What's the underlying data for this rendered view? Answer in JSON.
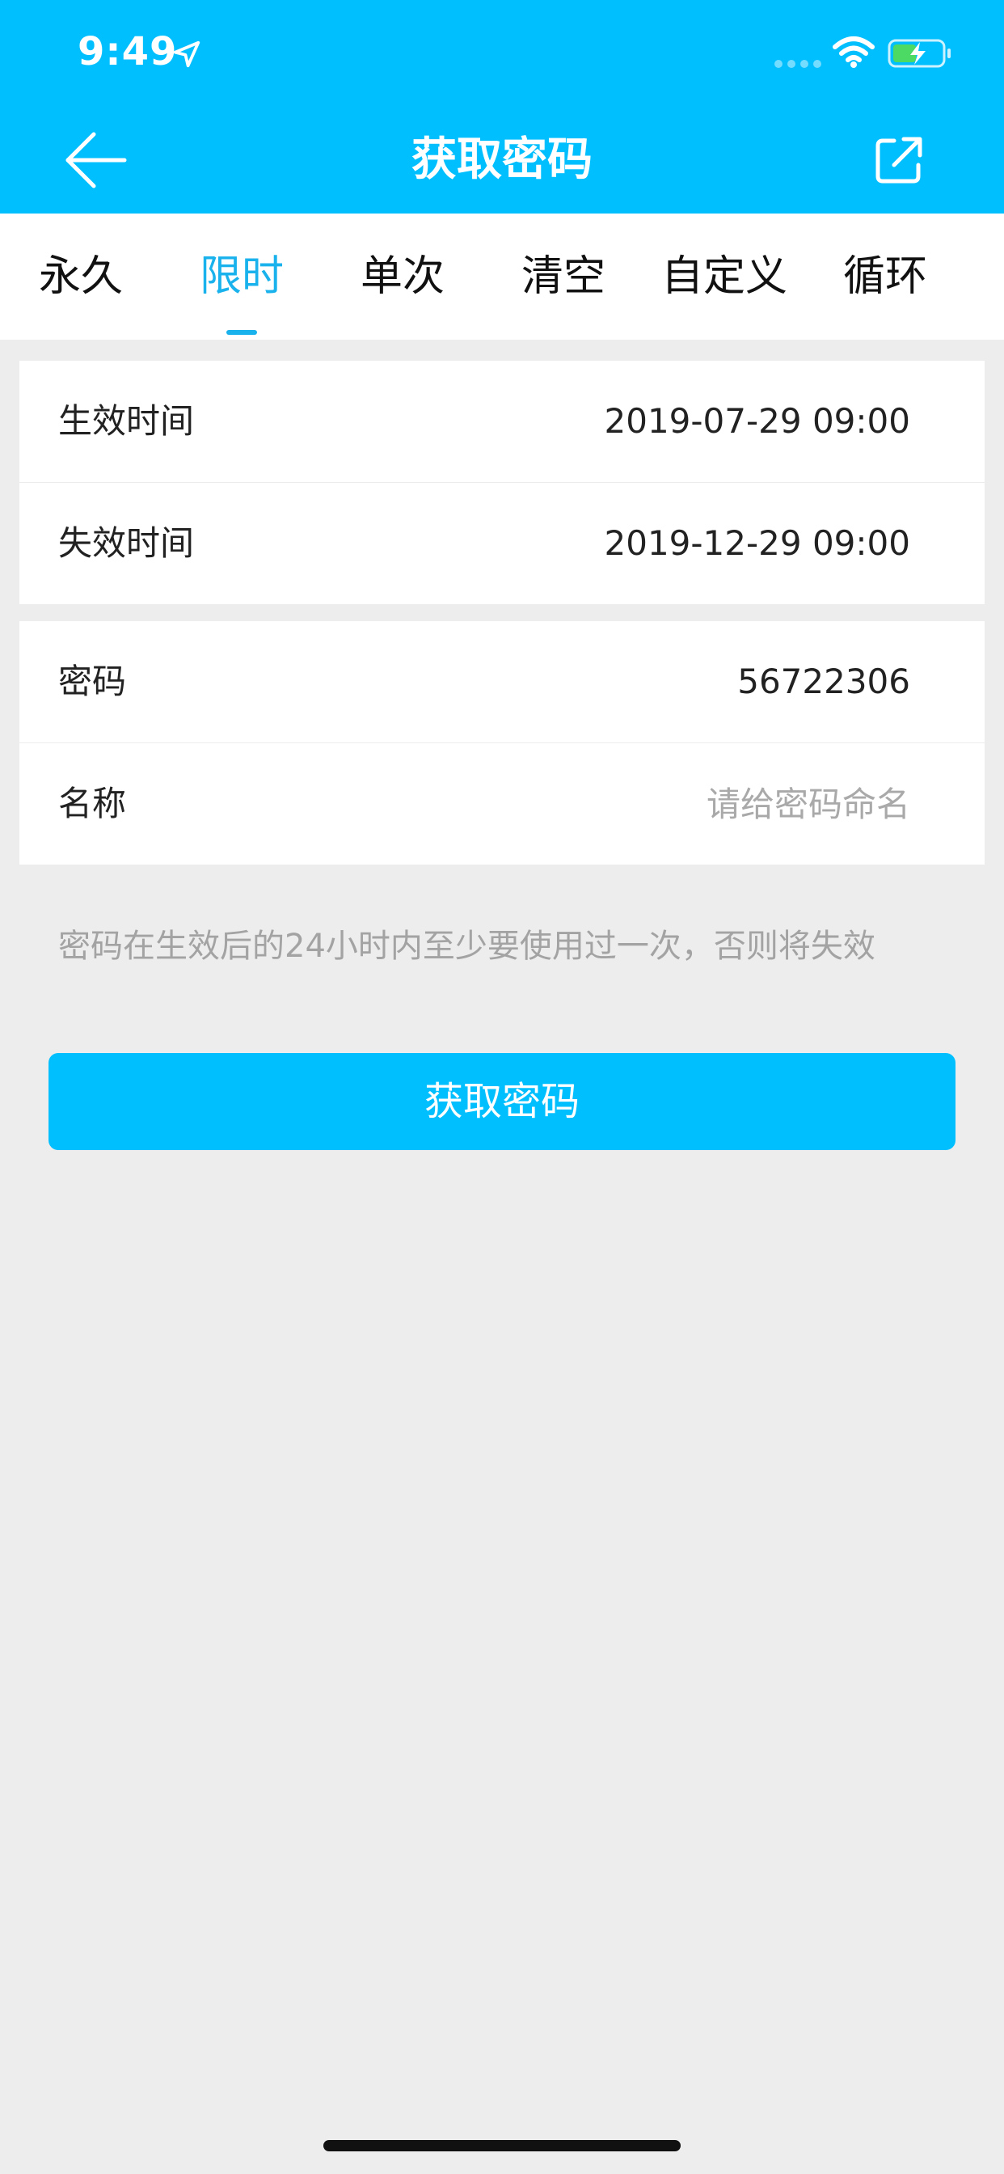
{
  "status_bar": {
    "time": "9:49",
    "icons": [
      "location-arrow-icon",
      "signal-icon",
      "wifi-icon",
      "battery-charging-icon"
    ],
    "battery_fill_color": "#4cd964"
  },
  "nav": {
    "title": "获取密码",
    "back_icon": "arrow-left-icon",
    "share_icon": "share-external-icon"
  },
  "tabs": [
    {
      "label": "永久"
    },
    {
      "label": "限时"
    },
    {
      "label": "单次"
    },
    {
      "label": "清空"
    },
    {
      "label": "自定义"
    },
    {
      "label": "循环"
    }
  ],
  "active_tab": "限时",
  "time_card": {
    "start_label": "生效时间",
    "start_value": "2019-07-29 09:00",
    "end_label": "失效时间",
    "end_value": "2019-12-29 09:00"
  },
  "password_card": {
    "password_label": "密码",
    "password_value": "56722306",
    "name_label": "名称",
    "name_placeholder": "请给密码命名",
    "name_value": ""
  },
  "hint": "密码在生效后的24小时内至少要使用过一次，否则将失效",
  "submit_label": "获取密码",
  "colors": {
    "primary": "#00bfff",
    "tab_active": "#1ab2ec",
    "background": "#ededed",
    "hint_text": "#a3a3a3"
  }
}
